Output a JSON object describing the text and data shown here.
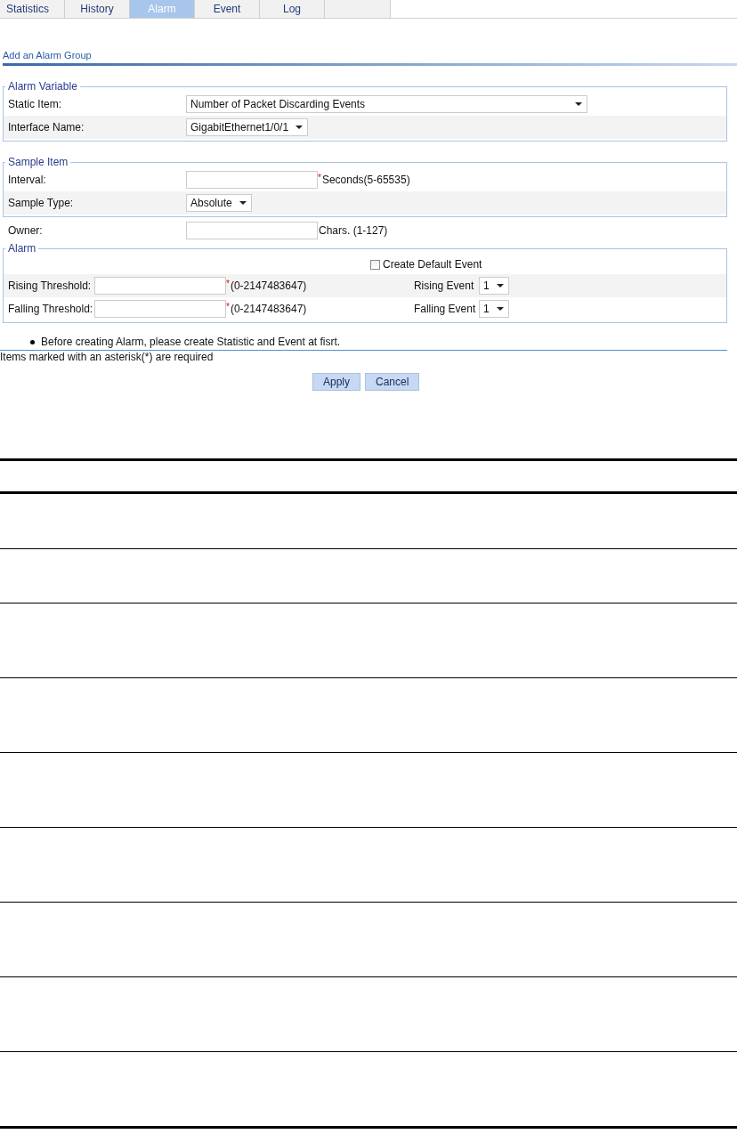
{
  "tabs": [
    {
      "label": "Statistics",
      "selected": false
    },
    {
      "label": "History",
      "selected": false
    },
    {
      "label": "Alarm",
      "selected": true
    },
    {
      "label": "Event",
      "selected": false
    },
    {
      "label": "Log",
      "selected": false
    }
  ],
  "section_title": "Add an Alarm Group",
  "alarm_variable": {
    "legend": "Alarm Variable",
    "static_item": {
      "label": "Static Item:",
      "value": "Number of Packet Discarding Events"
    },
    "interface_name": {
      "label": "Interface Name:",
      "value": "GigabitEthernet1/0/1"
    }
  },
  "sample_item": {
    "legend": "Sample Item",
    "interval": {
      "label": "Interval:",
      "required_mark": "*",
      "hint": "Seconds(5-65535)"
    },
    "sample_type": {
      "label": "Sample Type:",
      "value": "Absolute"
    }
  },
  "owner": {
    "label": "Owner:",
    "hint": "Chars. (1-127)"
  },
  "alarm": {
    "legend": "Alarm",
    "create_default_event": {
      "label": "Create Default Event",
      "checked": false
    },
    "rising_threshold": {
      "label": "Rising Threshold:",
      "required_mark": "*",
      "hint": "(0-2147483647)"
    },
    "rising_event": {
      "label": "Rising Event",
      "value": "1"
    },
    "falling_threshold": {
      "label": "Falling Threshold:",
      "required_mark": "*",
      "hint": "(0-2147483647)"
    },
    "falling_event": {
      "label": "Falling Event",
      "value": "1"
    }
  },
  "note": "Before creating Alarm, please create Statistic and Event at fisrt.",
  "required_note": "Items marked with an asterisk(*) are required",
  "buttons": [
    "Apply",
    "Cancel"
  ]
}
